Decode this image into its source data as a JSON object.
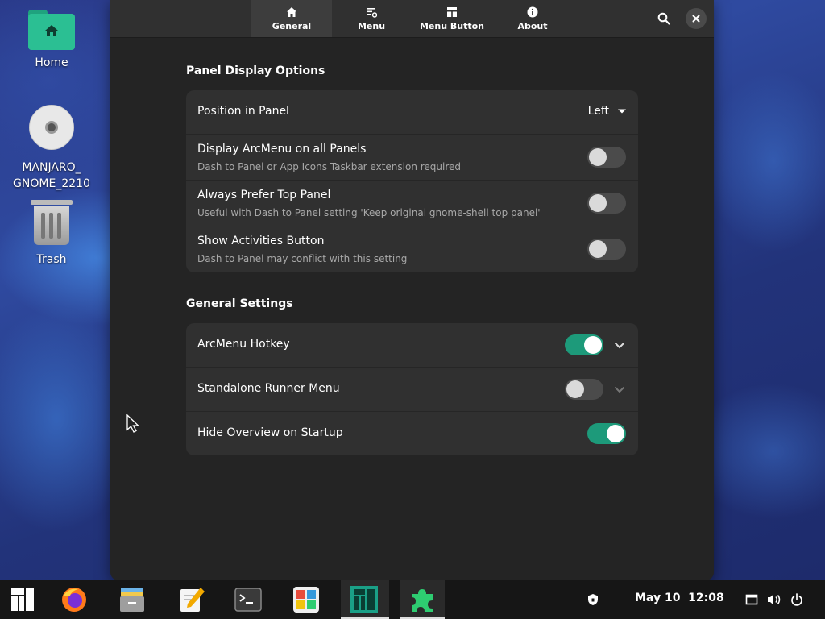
{
  "desktop": {
    "icons": [
      {
        "label": "Home"
      },
      {
        "label": "MANJARO_\nGNOME_2210"
      },
      {
        "label": "Trash"
      }
    ]
  },
  "window": {
    "tabs": [
      {
        "label": "General",
        "icon": "home-icon"
      },
      {
        "label": "Menu",
        "icon": "menu-settings-icon"
      },
      {
        "label": "Menu Button",
        "icon": "layout-icon"
      },
      {
        "label": "About",
        "icon": "info-icon"
      }
    ],
    "active_tab": "General",
    "panel_display": {
      "title": "Panel Display Options",
      "position": {
        "label": "Position in Panel",
        "value": "Left"
      },
      "rows": [
        {
          "title": "Display ArcMenu on all Panels",
          "subtitle": "Dash to Panel or App Icons Taskbar extension required",
          "on": false
        },
        {
          "title": "Always Prefer Top Panel",
          "subtitle": "Useful with Dash to Panel setting 'Keep original gnome-shell top panel'",
          "on": false
        },
        {
          "title": "Show Activities Button",
          "subtitle": "Dash to Panel may conflict with this setting",
          "on": false
        }
      ]
    },
    "general_settings": {
      "title": "General Settings",
      "rows": [
        {
          "title": "ArcMenu Hotkey",
          "on": true,
          "expandable": true
        },
        {
          "title": "Standalone Runner Menu",
          "on": false,
          "expandable": true
        },
        {
          "title": "Hide Overview on Startup",
          "on": true,
          "expandable": false
        }
      ]
    }
  },
  "taskbar": {
    "clock": "May 10  12:08",
    "apps": [
      "manjaro-logo-icon",
      "firefox-icon",
      "files-icon",
      "text-editor-icon",
      "terminal-icon",
      "software-icon",
      "manjaro-hello-icon",
      "extensions-icon"
    ],
    "tray": [
      "security-icon",
      "network-icon",
      "volume-icon",
      "power-icon"
    ]
  },
  "colors": {
    "accent": "#1d9a7a",
    "window_bg": "#242424",
    "card_bg": "#303030"
  }
}
